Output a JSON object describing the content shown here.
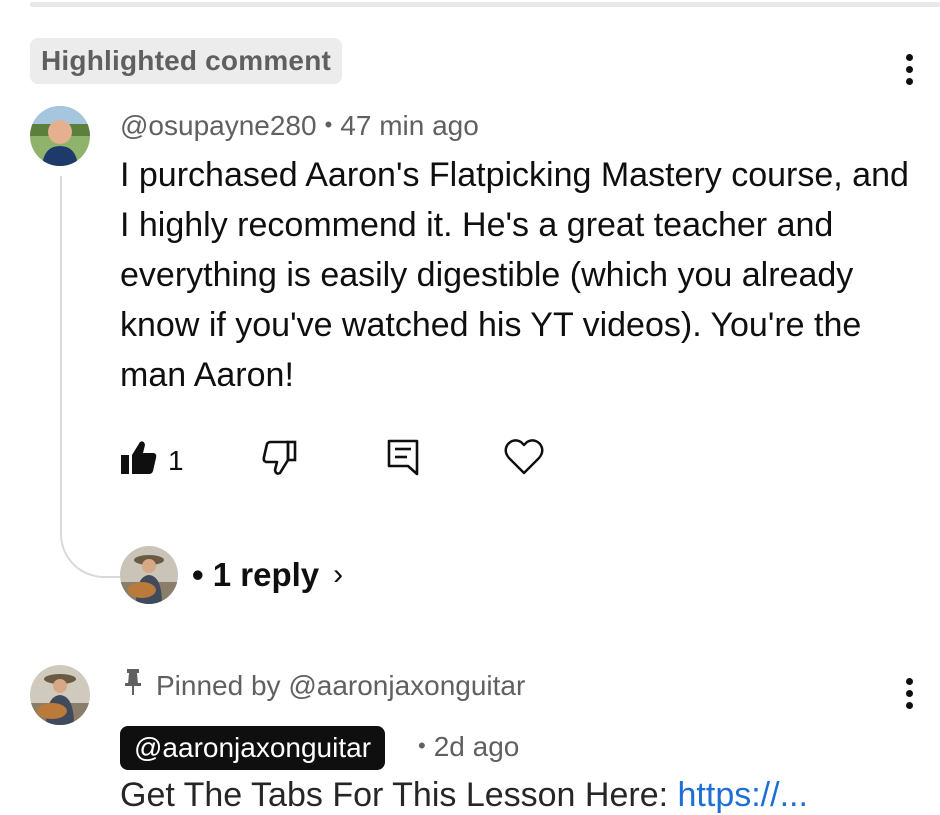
{
  "highlighted_label": "Highlighted comment",
  "comment": {
    "author": "@osupayne280",
    "time": "47 min ago",
    "separator": "•",
    "body": "I purchased Aaron's Flatpicking Mastery course, and I highly recommend it. He's a great teacher and everything is easily digestible (which you already know if you've watched his YT videos). You're the man Aaron!",
    "like_count": "1",
    "replies_label": "• 1 reply",
    "replies_chevron": "›"
  },
  "pinned_comment": {
    "pinned_label": "Pinned by @aaronjaxonguitar",
    "author": "@aaronjaxonguitar",
    "separator": "•",
    "time": "2d ago",
    "body_preview": "Get The Tabs For This Lesson Here:",
    "link_preview": "https://..."
  },
  "icons": {
    "like": "thumbs-up-filled-icon",
    "dislike": "thumbs-down-outline-icon",
    "reply": "reply-comment-icon",
    "heart": "heart-outline-icon",
    "more": "more-vertical-icon",
    "pin": "pin-icon",
    "chevron": "chevron-right-icon"
  },
  "colors": {
    "text": "#0f0f0f",
    "secondary": "#606060",
    "chip_bg": "#ececec",
    "author_chip_bg": "#0f0f0f",
    "link": "#065fd4"
  }
}
